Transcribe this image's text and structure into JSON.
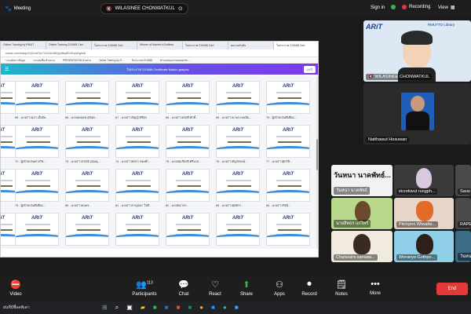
{
  "topbar": {
    "app": "Meeting",
    "speaker": "WILASINEE CHONWATKUL",
    "sign_in": "Sign in",
    "recording": "Recording",
    "view": "View"
  },
  "browser": {
    "tabs": [
      "Online Training by RMUT",
      "Online Training 21/5/68 Cert",
      "ใบประกาศ 21/5/68 Cert",
      "Winner of Nomen's Endless",
      "ใบประกาศ 21/5/68 Cert",
      "ผลงานอันดับ",
      "ใบประกาศ 21/5/68 Cert"
    ],
    "url": "canva.com/design/DAGmeTscTh/U1dUtNtQpNftqsBVtZnpshg/edit",
    "bookmarks": [
      "ระบบจัดการข้อมูล",
      "ระบบลงชื่อเข้าอบรม",
      "PRESENTATION ตัวอย่าง",
      "Online Training by R...",
      "ใบประกาศ 21/5/68",
      "ทำแบบสอบถามผลตอบรับ..."
    ],
    "canva_title": "ใบประกาศ 21/5/68 Certificate Motion graphic",
    "share_label": "แชร์"
  },
  "certificates": {
    "captions": [
      [
        "65 - นางสาวนภา เต็งจิน",
        "66 - นายนพฤษพ์ สุจันท...",
        "67 - นางสาวกัญญ์ ศรีสุข",
        "68 - นางสาวอรฤดี ศักดิ์...",
        "69 - นางสาวนวพร พลเมือ...",
        "70 - ผู้เข้าอบรมดีเยี่ยม..."
      ],
      [
        "72 - ผู้เข้าอบรมทางวิช...",
        "73 - นางสาวกรรณี แจ่มนุ...",
        "74 - นางสาวพัชรา ทองคำ...",
        "75 - นายสมเกียรติ ศรีนวล...",
        "76 - นางสาวธัญลักษณ์...",
        "77 - นางสาวศุกร์ลี..."
      ],
      [
        "79 - ผู้เข้าอบรมดีเยี่ยม...",
        "80 - นางสาวธนพร...",
        "81 - นางสาวกาญจนา ใจดี...",
        "82 - นายธนากร...",
        "83 - นางสาวสุพัตรา...",
        "84 - นางสาวรัชนี..."
      ],
      [
        "",
        "",
        "",
        "",
        "",
        ""
      ]
    ],
    "logo": "ARiT"
  },
  "participants": {
    "main_speaker": "WILASINEE CHONWATKUL",
    "second": "Natthawut Hosuwan",
    "banner": "วันหนา นาคพัทธ์...",
    "grid": [
      "วันหนา นาคพัทธ์",
      "eicrekwut rungph...",
      "Sarai Ka...",
      "นายสิทธร แก่ไพร์",
      "Pitchpon Wiwatta...",
      "RAPEE",
      "Chanisara sansaw...",
      "Woranya Gothpo...",
      "วันหนา"
    ],
    "speaker_brand": "RMUTTO Library"
  },
  "toolbar": {
    "video": "Video",
    "participants": "Participants",
    "participants_count": "113",
    "chat": "Chat",
    "react": "React",
    "share": "Share",
    "apps": "Apps",
    "record": "Record",
    "notes": "Notes",
    "more": "More",
    "end": "End"
  },
  "taskbar": {
    "status": "ฝนที่มีพื้อคพิเตา"
  }
}
